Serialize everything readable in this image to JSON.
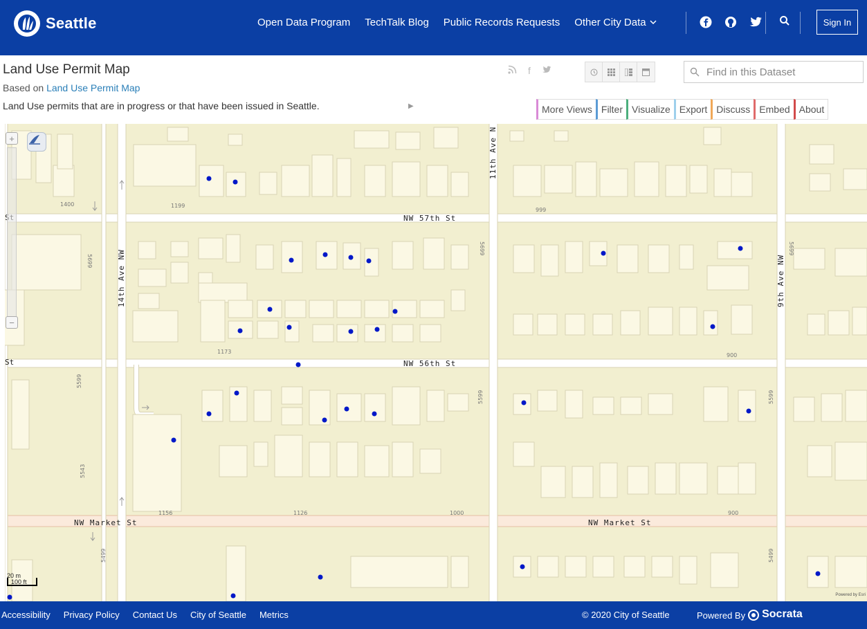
{
  "header": {
    "brand": "Seattle",
    "nav": [
      {
        "label": "Open Data Program"
      },
      {
        "label": "TechTalk Blog"
      },
      {
        "label": "Public Records Requests"
      },
      {
        "label": "Other City Data"
      }
    ],
    "social_icons": [
      "facebook-icon",
      "github-icon",
      "twitter-icon"
    ],
    "sign_in": "Sign In",
    "brand_color": "#0b3fa4"
  },
  "dataset": {
    "title": "Land Use Permit Map",
    "based_on_prefix": "Based on",
    "based_on_link": "Land Use Permit Map",
    "description": "Land Use permits that are in progress or that have been issued in Seattle.",
    "search_placeholder": "Find in this Dataset"
  },
  "tabs": [
    {
      "label": "More Views",
      "color": "#d98ad6"
    },
    {
      "label": "Filter",
      "color": "#5b9bd5"
    },
    {
      "label": "Visualize",
      "color": "#4caf7d"
    },
    {
      "label": "Export",
      "color": "#9ed0ec"
    },
    {
      "label": "Discuss",
      "color": "#f0a858"
    },
    {
      "label": "Embed",
      "color": "#e06b6b"
    },
    {
      "label": "About",
      "color": "#d24a4a"
    }
  ],
  "map": {
    "streets": {
      "nw57": "NW 57th St",
      "nw56": "NW 56th St",
      "market_w": "NW Market St",
      "market_e": "NW Market St",
      "ave14": "14th Ave NW",
      "ave11": "11th Ave N",
      "ave9": "9th Ave NW",
      "st_left_a": "St",
      "st_left_b": "St"
    },
    "address_labels": {
      "a1400": "1400",
      "a1199": "1199",
      "a999": "999",
      "a5699a": "5699",
      "a5699b": "5699",
      "a5699c": "5699",
      "a1173": "1173",
      "a900a": "900",
      "a5599a": "5599",
      "a5599b": "5599",
      "a5599c": "5599",
      "a5543": "5543",
      "a1156": "1156",
      "a1126": "1126",
      "a1000": "1000",
      "a900b": "900",
      "a5499a": "5499",
      "a5499b": "5499"
    },
    "scale_m": "20 m",
    "scale_ft": "100 ft",
    "powered_by": "Powered by Esri",
    "marker_color": "#0018c8"
  },
  "footer": {
    "links": [
      "Accessibility",
      "Privacy Policy",
      "Contact Us",
      "City of Seattle",
      "Metrics"
    ],
    "copyright": "© 2020 City of Seattle",
    "powered_by": "Powered By",
    "socrata": "Socrata"
  }
}
